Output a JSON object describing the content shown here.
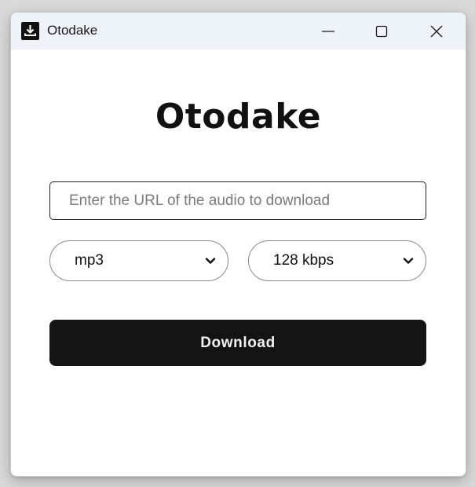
{
  "window": {
    "title": "Otodake",
    "icon": "download-icon",
    "controls": [
      "minimize-icon",
      "maximize-icon",
      "close-icon"
    ]
  },
  "main": {
    "heading": "Otodake",
    "url_input": {
      "value": "",
      "placeholder": "Enter the URL of the audio to download"
    },
    "format_select": {
      "selected": "mp3"
    },
    "bitrate_select": {
      "selected": "128 kbps"
    },
    "download_label": "Download"
  },
  "colors": {
    "titlebar_bg": "#eef3fa",
    "button_bg": "#141414",
    "button_text": "#f2f2f2"
  }
}
